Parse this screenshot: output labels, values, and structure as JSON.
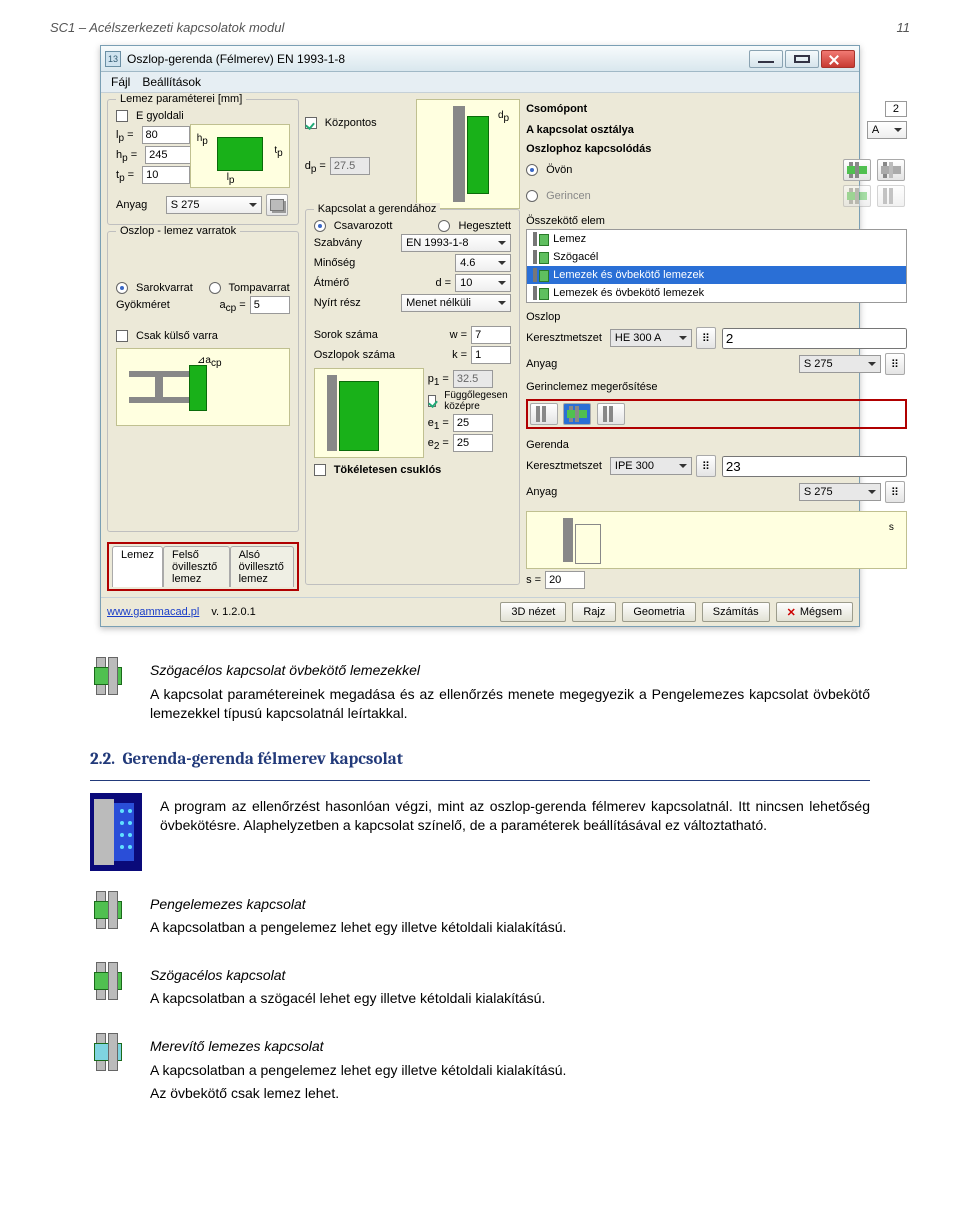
{
  "page_header": {
    "left": "SC1 – Acélszerkezeti kapcsolatok modul",
    "right": "11"
  },
  "dialog": {
    "title": "Oszlop-gerenda (Félmerev) EN 1993-1-8",
    "icon": "13",
    "menu": {
      "file": "Fájl",
      "settings": "Beállítások"
    },
    "plate": {
      "legend": "Lemez paraméterei [mm]",
      "e_oneside": "E gyoldali",
      "lp_lbl": "l",
      "lp_sub": "p",
      "eq": " =",
      "lp": "80",
      "hp_lbl": "h",
      "hp_sub": "p",
      "hp": "245",
      "tp_lbl": "t",
      "tp_sub": "p",
      "tp": "10",
      "material_lbl": "Anyag",
      "material": "S 275"
    },
    "weld": {
      "legend": "Oszlop - lemez varratok",
      "r_fillet": "Sarokvarrat",
      "r_butt": "Tompavarrat",
      "throat_lbl": "Gyökméret",
      "throat_sym_a": "a",
      "throat_sym_sub": "cp",
      "throat_eq": " =",
      "throat": "5",
      "outer_only": "Csak külső varra"
    },
    "tabs": {
      "t1": "Lemez",
      "t2": "Felső övillesztő lemez",
      "t3": "Alsó övillesztő lemez"
    },
    "center": {
      "centered": "Központos",
      "dp_lbl": "d",
      "dp_sub": "p",
      "dp_eq": " =",
      "dp": "27.5",
      "beamconn": {
        "legend": "Kapcsolat a gerendához",
        "r_bolted": "Csavarozott",
        "r_welded": "Hegesztett",
        "std_lbl": "Szabvány",
        "std": "EN 1993-1-8",
        "grade_lbl": "Minőség",
        "grade": "4.6",
        "dia_lbl": "Átmérő",
        "dia_sym": "d =",
        "dia": "10",
        "thread_lbl": "Nyírt rész",
        "thread": "Menet nélküli",
        "rows_lbl": "Sorok száma",
        "w_sym": "w =",
        "w": "7",
        "cols_lbl": "Oszlopok száma",
        "k_sym": "k =",
        "k": "1",
        "p1_sym": "p",
        "p1_sub": "1",
        "e_eq": " =",
        "p1": "32.5",
        "vcenter": "Függőlegesen középre",
        "e1_sym": "e",
        "e1_sub": "1",
        "e1": "25",
        "e2_sym": "e",
        "e2_sub": "2",
        "e2": "25",
        "perfect_hinge": "Tökéletesen csuklós"
      }
    },
    "right": {
      "node_lbl": "Csomópont",
      "node": "2",
      "class_lbl": "A kapcsolat osztálya",
      "class": "A",
      "col_attach": "Oszlophoz kapcsolódás",
      "r_flange": "Övön",
      "r_web": "Gerincen",
      "connector_lbl": "Összekötő elem",
      "li1": "Lemez",
      "li2": "Szögacél",
      "li3": "Lemezek és övbekötő lemezek",
      "li4": "Lemezek és övbekötő lemezek",
      "column_lbl": "Oszlop",
      "col_section_lbl": "Keresztmetszet",
      "col_section": "HE 300 A",
      "col_mat_lbl": "Anyag",
      "col_mat": "S 275",
      "stiff_lbl": "Gerinclemez megerősítése",
      "beam_lbl": "Gerenda",
      "beam_section_lbl": "Keresztmetszet",
      "beam_section": "IPE 300",
      "beam_mat_lbl": "Anyag",
      "beam_mat": "S 275",
      "s_sym": "s =",
      "s": "20",
      "col_idx": "2",
      "beam_idx": "23"
    },
    "footer": {
      "link": "www.gammacad.pl",
      "version": "v. 1.2.0.1",
      "b_3d": "3D nézet",
      "b_draw": "Rajz",
      "b_geom": "Geometria",
      "b_calc": "Számítás",
      "b_cancel": "Mégsem"
    }
  },
  "doc": {
    "p1_title": "Szögacélos kapcsolat övbekötő lemezekkel",
    "p1_body": "A kapcsolat paramétereinek megadása és az ellenőrzés menete megegyezik a Pengelemezes kapcsolat övbekötő lemezekkel típusú kapcsolatnál leírtakkal.",
    "h2_num": "2.2.",
    "h2": "Gerenda-gerenda félmerev kapcsolat",
    "p2": "A program az ellenőrzést hasonlóan végzi, mint az oszlop-gerenda félmerev kapcsolatnál. Itt nincsen lehetőség övbekötésre. Alaphelyzetben a kapcsolat színelő, de a paraméterek beállításával ez változtatható.",
    "i3_t": "Pengelemezes kapcsolat",
    "i3_b": "A kapcsolatban a pengelemez lehet egy illetve kétoldali kialakítású.",
    "i4_t": "Szögacélos kapcsolat",
    "i4_b": "A kapcsolatban a szögacél lehet egy illetve kétoldali kialakítású.",
    "i5_t": "Merevítő lemezes kapcsolat",
    "i5_b": "A kapcsolatban a pengelemez lehet egy illetve kétoldali kialakítású.",
    "i5_c": "Az övbekötő csak lemez lehet."
  }
}
